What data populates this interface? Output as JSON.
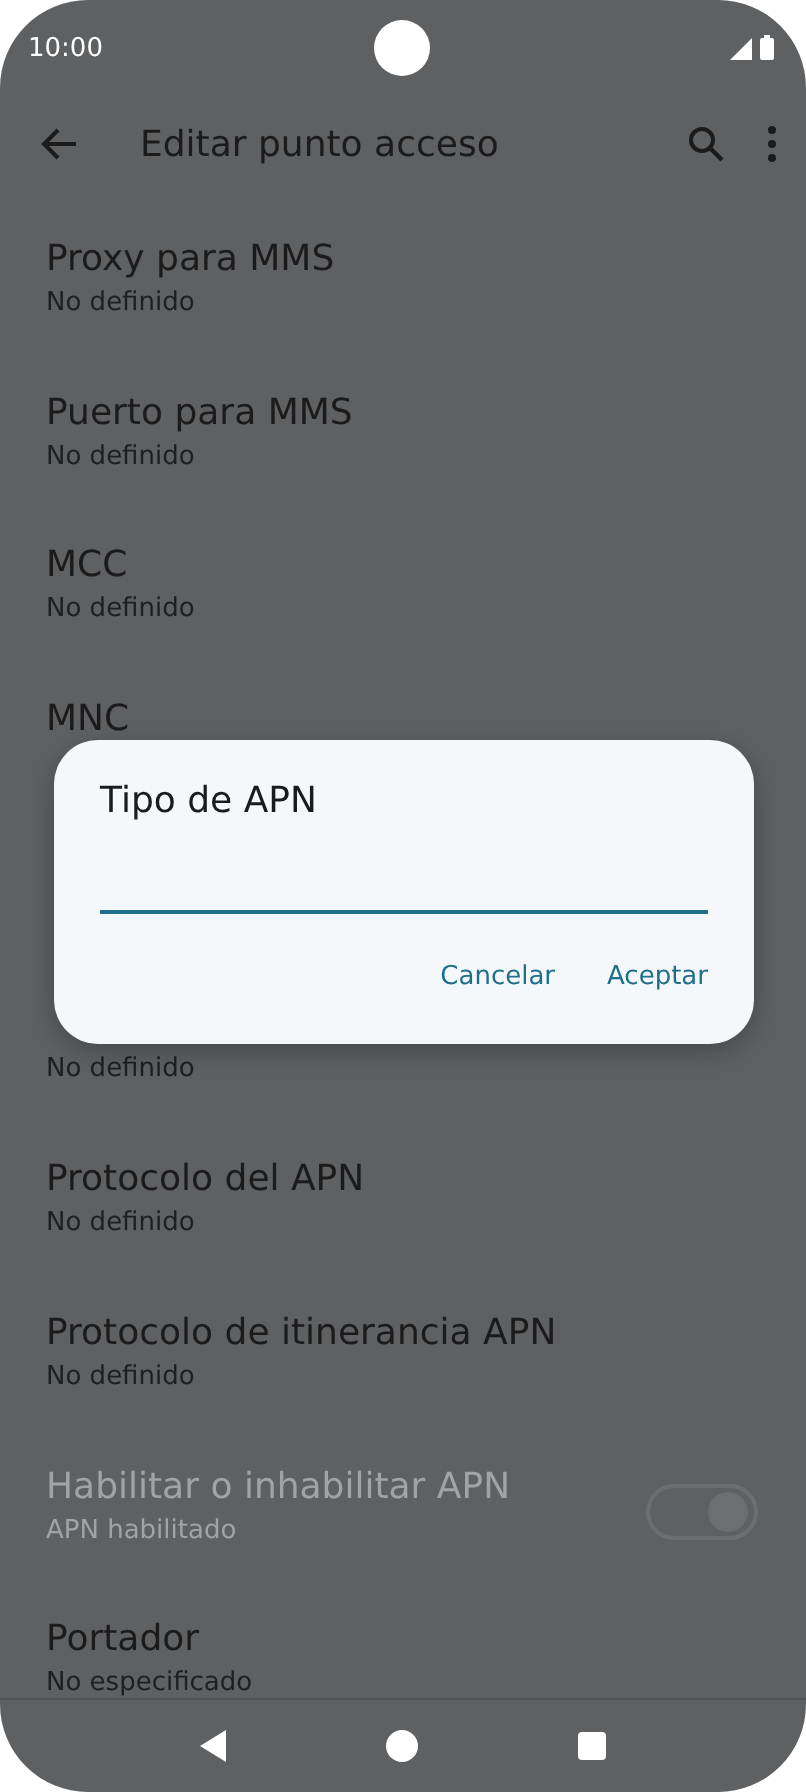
{
  "status_bar": {
    "time": "10:00"
  },
  "top_bar": {
    "title": "Editar punto acceso"
  },
  "settings": [
    {
      "title": "Proxy para MMS",
      "subtitle": "No definido",
      "disabled": false
    },
    {
      "title": "Puerto para MMS",
      "subtitle": "No definido",
      "disabled": false
    },
    {
      "title": "MCC",
      "subtitle": "No definido",
      "disabled": false
    },
    {
      "title": "MNC",
      "disabled": false
    },
    {
      "subtitle": "No definido",
      "disabled": false
    },
    {
      "title": "Protocolo del APN",
      "subtitle": "No definido",
      "disabled": false
    },
    {
      "title": "Protocolo de itinerancia APN",
      "subtitle": "No definido",
      "disabled": false
    },
    {
      "title": "Habilitar o inhabilitar APN",
      "subtitle": "APN habilitado",
      "disabled": true,
      "switch": {
        "on": true
      }
    },
    {
      "title": "Portador",
      "subtitle": "No especificado",
      "disabled": false
    }
  ],
  "dialog": {
    "title": "Tipo de APN",
    "buttons": [
      "Cancelar",
      "Aceptar"
    ]
  }
}
